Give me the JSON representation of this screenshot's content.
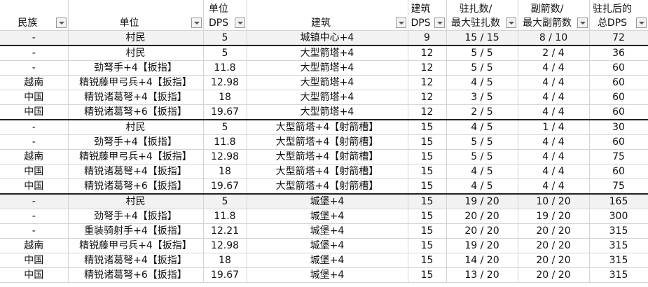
{
  "headers": [
    {
      "line1": "民族",
      "line2": ""
    },
    {
      "line1": "单位",
      "line2": ""
    },
    {
      "line1": "单位",
      "line2": "DPS"
    },
    {
      "line1": "建筑",
      "line2": ""
    },
    {
      "line1": "建筑",
      "line2": "DPS"
    },
    {
      "line1": "驻扎数/",
      "line2": "最大驻扎数"
    },
    {
      "line1": "副箭数/",
      "line2": "最大副箭数"
    },
    {
      "line1": "驻扎后的",
      "line2": "总DPS"
    }
  ],
  "rows": [
    {
      "civ": "-",
      "unit": "村民",
      "unit_dps": "5",
      "building": "城镇中心+4",
      "bld_dps": "9",
      "garrison": "15 / 15",
      "arrows": "8 / 10",
      "total": "72"
    },
    {
      "civ": "-",
      "unit": "村民",
      "unit_dps": "5",
      "building": "大型箭塔+4",
      "bld_dps": "12",
      "garrison": "5 / 5",
      "arrows": "2 / 4",
      "total": "36"
    },
    {
      "civ": "-",
      "unit": "劲弩手+4【扳指】",
      "unit_dps": "11.8",
      "building": "大型箭塔+4",
      "bld_dps": "12",
      "garrison": "5 / 5",
      "arrows": "4 / 4",
      "total": "60"
    },
    {
      "civ": "越南",
      "unit": "精锐藤甲弓兵+4【扳指】",
      "unit_dps": "12.98",
      "building": "大型箭塔+4",
      "bld_dps": "12",
      "garrison": "4 / 5",
      "arrows": "4 / 4",
      "total": "60"
    },
    {
      "civ": "中国",
      "unit": "精锐诸葛弩+4【扳指】",
      "unit_dps": "18",
      "building": "大型箭塔+4",
      "bld_dps": "12",
      "garrison": "3 / 5",
      "arrows": "4 / 4",
      "total": "60"
    },
    {
      "civ": "中国",
      "unit": "精锐诸葛弩+6【扳指】",
      "unit_dps": "19.67",
      "building": "大型箭塔+4",
      "bld_dps": "12",
      "garrison": "2 / 5",
      "arrows": "4 / 4",
      "total": "60"
    },
    {
      "civ": "-",
      "unit": "村民",
      "unit_dps": "5",
      "building": "大型箭塔+4【射箭槽】",
      "bld_dps": "15",
      "garrison": "4 / 5",
      "arrows": "1 / 4",
      "total": "30"
    },
    {
      "civ": "-",
      "unit": "劲弩手+4【扳指】",
      "unit_dps": "11.8",
      "building": "大型箭塔+4【射箭槽】",
      "bld_dps": "15",
      "garrison": "5 / 5",
      "arrows": "4 / 4",
      "total": "60"
    },
    {
      "civ": "越南",
      "unit": "精锐藤甲弓兵+4【扳指】",
      "unit_dps": "12.98",
      "building": "大型箭塔+4【射箭槽】",
      "bld_dps": "15",
      "garrison": "5 / 5",
      "arrows": "4 / 4",
      "total": "75"
    },
    {
      "civ": "中国",
      "unit": "精锐诸葛弩+4【扳指】",
      "unit_dps": "18",
      "building": "大型箭塔+4【射箭槽】",
      "bld_dps": "15",
      "garrison": "4 / 5",
      "arrows": "4 / 4",
      "total": "60"
    },
    {
      "civ": "中国",
      "unit": "精锐诸葛弩+6【扳指】",
      "unit_dps": "19.67",
      "building": "大型箭塔+4【射箭槽】",
      "bld_dps": "15",
      "garrison": "4 / 5",
      "arrows": "4 / 4",
      "total": "75"
    },
    {
      "civ": "-",
      "unit": "村民",
      "unit_dps": "5",
      "building": "城堡+4",
      "bld_dps": "15",
      "garrison": "19 / 20",
      "arrows": "10 / 20",
      "total": "165"
    },
    {
      "civ": "-",
      "unit": "劲弩手+4【扳指】",
      "unit_dps": "11.8",
      "building": "城堡+4",
      "bld_dps": "15",
      "garrison": "20 / 20",
      "arrows": "19 / 20",
      "total": "300"
    },
    {
      "civ": "-",
      "unit": "重装骑射手+4【扳指】",
      "unit_dps": "12.21",
      "building": "城堡+4",
      "bld_dps": "15",
      "garrison": "20 / 20",
      "arrows": "20 / 20",
      "total": "315"
    },
    {
      "civ": "越南",
      "unit": "精锐藤甲弓兵+4【扳指】",
      "unit_dps": "12.98",
      "building": "城堡+4",
      "bld_dps": "15",
      "garrison": "19 / 20",
      "arrows": "20 / 20",
      "total": "315"
    },
    {
      "civ": "中国",
      "unit": "精锐诸葛弩+4【扳指】",
      "unit_dps": "18",
      "building": "城堡+4",
      "bld_dps": "15",
      "garrison": "14 / 20",
      "arrows": "20 / 20",
      "total": "315"
    },
    {
      "civ": "中国",
      "unit": "精锐诸葛弩+6【扳指】",
      "unit_dps": "19.67",
      "building": "城堡+4",
      "bld_dps": "15",
      "garrison": "13 / 20",
      "arrows": "20 / 20",
      "total": "315"
    }
  ],
  "shaded_rows": [
    0,
    11
  ],
  "separator_rows": [
    1,
    6,
    11
  ],
  "icons": {
    "filter": "filter-dropdown-icon"
  }
}
